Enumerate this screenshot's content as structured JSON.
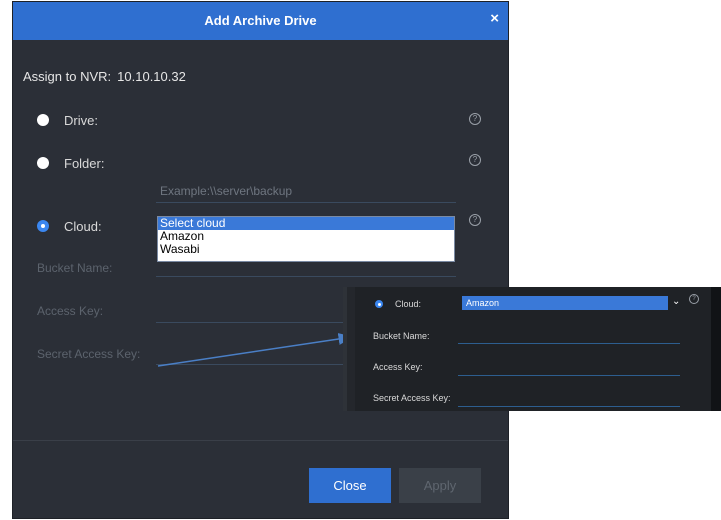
{
  "dialog": {
    "title": "Add Archive Drive",
    "close_icon": "×",
    "assign_label": "Assign to NVR:",
    "assign_value": "10.10.10.32",
    "help_icon": "?",
    "options": [
      {
        "label": "Drive:",
        "selected": false
      },
      {
        "label": "Folder:",
        "selected": false
      },
      {
        "label": "Cloud:",
        "selected": true
      }
    ],
    "folder_placeholder": "Example:\\\\server\\backup",
    "cloud_options": [
      "Select cloud",
      "Amazon",
      "Wasabi"
    ],
    "cloud_selected_index": 0,
    "fields": {
      "bucket_name": "Bucket Name:",
      "access_key": "Access Key:",
      "secret_access_key": "Secret Access Key:"
    },
    "buttons": {
      "close": "Close",
      "apply": "Apply"
    }
  },
  "inset": {
    "cloud_label": "Cloud:",
    "cloud_value": "Amazon",
    "chevron_icon": "⌄",
    "help_icon": "?",
    "bucket_name": "Bucket Name:",
    "access_key": "Access Key:",
    "secret_access_key": "Secret Access Key:"
  },
  "colors": {
    "accent": "#2f6fd0",
    "dialog_bg": "#2b2f37",
    "arrow": "#4a7fc6"
  }
}
